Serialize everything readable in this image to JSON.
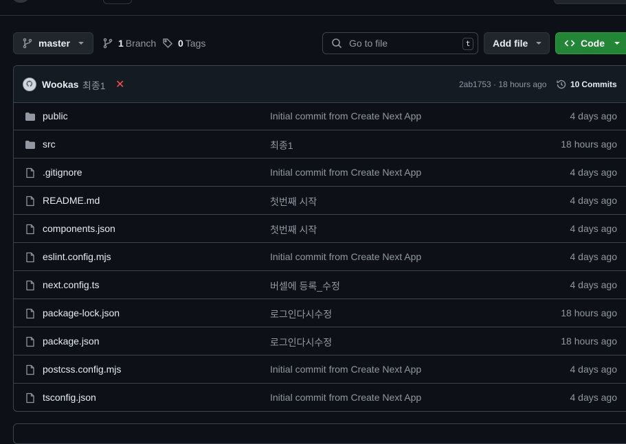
{
  "branch_selector": {
    "label": "master"
  },
  "branch_count": {
    "number": "1",
    "label": "Branch"
  },
  "tag_count": {
    "number": "0",
    "label": "Tags"
  },
  "search": {
    "placeholder": "Go to file",
    "shortcut": "t"
  },
  "add_file": {
    "label": "Add file"
  },
  "code_button": {
    "label": "Code"
  },
  "latest_commit": {
    "author": "Wookas",
    "message": "최종1",
    "status": "✕",
    "hash_time": "2ab1753 · 18 hours ago",
    "commits_number": "10",
    "commits_label": "Commits"
  },
  "files": [
    {
      "type": "folder",
      "name": "public",
      "message": "Initial commit from Create Next App",
      "date": "4 days ago"
    },
    {
      "type": "folder",
      "name": "src",
      "message": "최종1",
      "date": "18 hours ago"
    },
    {
      "type": "file",
      "name": ".gitignore",
      "message": "Initial commit from Create Next App",
      "date": "4 days ago"
    },
    {
      "type": "file",
      "name": "README.md",
      "message": "첫번째 시작",
      "date": "4 days ago"
    },
    {
      "type": "file",
      "name": "components.json",
      "message": "첫번째 시작",
      "date": "4 days ago"
    },
    {
      "type": "file",
      "name": "eslint.config.mjs",
      "message": "Initial commit from Create Next App",
      "date": "4 days ago"
    },
    {
      "type": "file",
      "name": "next.config.ts",
      "message": "버셀에 등록_수정",
      "date": "4 days ago"
    },
    {
      "type": "file",
      "name": "package-lock.json",
      "message": "로그인다시수정",
      "date": "18 hours ago"
    },
    {
      "type": "file",
      "name": "package.json",
      "message": "로그인다시수정",
      "date": "18 hours ago"
    },
    {
      "type": "file",
      "name": "postcss.config.mjs",
      "message": "Initial commit from Create Next App",
      "date": "4 days ago"
    },
    {
      "type": "file",
      "name": "tsconfig.json",
      "message": "Initial commit from Create Next App",
      "date": "4 days ago"
    }
  ],
  "colors": {
    "background": "#0d1117",
    "border": "#3d444d",
    "muted_text": "#9198a1",
    "code_button": "#238636",
    "error": "#f85149"
  }
}
